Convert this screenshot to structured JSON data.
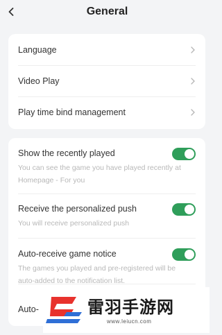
{
  "header": {
    "title": "General",
    "back_icon": "chevron-left-icon"
  },
  "nav_list": {
    "items": [
      {
        "label": "Language"
      },
      {
        "label": "Video Play"
      },
      {
        "label": "Play time bind management"
      }
    ]
  },
  "settings": [
    {
      "title": "Show the recently played",
      "description": "You can see the game you have played recently at Homepage - For you",
      "enabled": true
    },
    {
      "title": "Receive the personalized push",
      "description": "You will receive personalized push",
      "enabled": true
    },
    {
      "title": "Auto-receive game notice",
      "description": "The games you played and pre-registered will be auto-added to the notification list.",
      "enabled": true
    },
    {
      "title": "Auto-"
    }
  ],
  "watermark": {
    "text": "雷羽手游网",
    "url": "www.leiucn.com"
  },
  "colors": {
    "toggle_on": "#2f9e5a",
    "background": "#f3f4f6",
    "card": "#ffffff",
    "logo_red": "#e8322d",
    "logo_blue": "#2f6fd6"
  }
}
